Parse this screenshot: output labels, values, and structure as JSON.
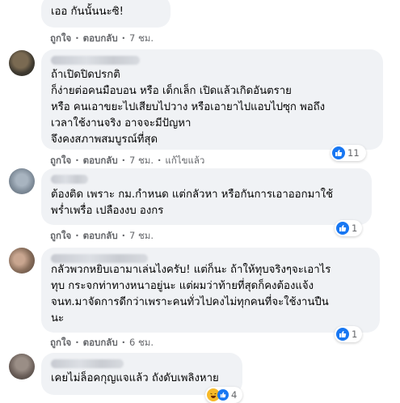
{
  "actions": {
    "like": "ถูกใจ",
    "reply": "ตอบกลับ",
    "edited": "แก้ไขแล้ว"
  },
  "comments": [
    {
      "text": "เออ กันนั้นนะซิ!",
      "time": "7 ชม."
    },
    {
      "text": "ถ้าเปิดปิดปรกติ\nก็ง่ายต่อคนมือบอน หรือ เด็กเล็ก เปิดแล้วเกิดอันตราย\nหรือ คนเอาขยะไปเสียบไปวาง หรือเอายาไปแอบไปซุก พอถึง\nเวลาใช้งานจริง อาจจะมีปัญหา\nจึงคงสภาพสมบูรณ์ที่สุด",
      "time": "7 ชม.",
      "reaction": {
        "icon": "like-icon",
        "count": "11"
      }
    },
    {
      "text": "ต้องติด เพราะ กม.กำหนด แต่กลัวหา หรือกันการเอาออกมาใช้\nพร่ำเพรื่อ เปลืองงบ องกร",
      "time": "7 ชม.",
      "reaction": {
        "icon": "like-icon",
        "count": "1"
      }
    },
    {
      "text": "กลัวพวกหยิบเอามาเล่นไงครับ! แต่ก็นะ ถ้าให้ทุบจริงๆจะเอาไร\nทุบ กระจกท่าทางหนาอยู่นะ แต่ผมว่าท้ายที่สุดก็คงต้องแจ้ง\nจนท.มาจัดการดีกว่าเพราะคนทั่วไปคงไม่ทุกคนที่จะใช้งานปืน\nนะ",
      "time": "6 ชม.",
      "reaction": {
        "icon": "like-icon",
        "count": "1"
      }
    },
    {
      "text": "เคยไม่ล็อคกุญแจแล้ว ถังดับเพลิงหาย",
      "reaction": {
        "icon": "haha-icon",
        "count": "4"
      }
    }
  ],
  "colors": {
    "bubble": "#f0f2f5",
    "meta": "#65676b",
    "like_blue": "#1877f2",
    "haha_yellow": "#f7b928"
  }
}
